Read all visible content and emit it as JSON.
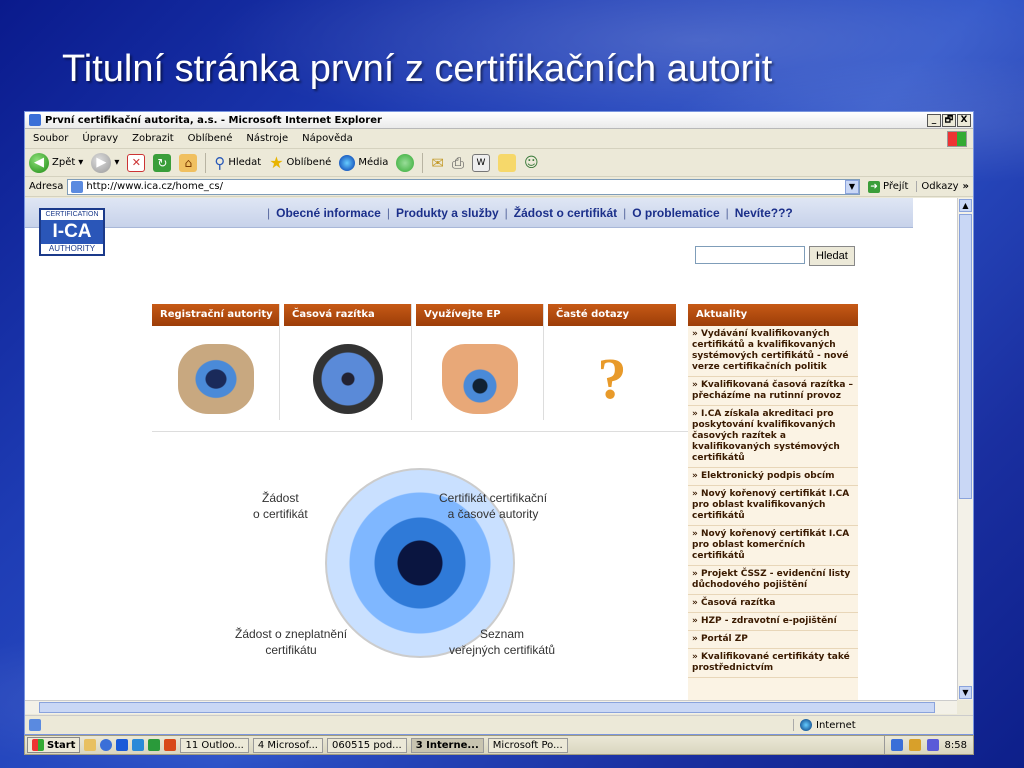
{
  "slide": {
    "title": "Titulní stránka první z certifikačních autorit"
  },
  "window": {
    "title": "První certifikační autorita, a.s. - Microsoft Internet Explorer",
    "controls": [
      "_",
      "🗗",
      "X"
    ]
  },
  "menu": [
    "Soubor",
    "Úpravy",
    "Zobrazit",
    "Oblíbené",
    "Nástroje",
    "Nápověda"
  ],
  "toolbar": {
    "back": "Zpět",
    "search": "Hledat",
    "favorites": "Oblíbené",
    "media": "Média"
  },
  "address": {
    "label": "Adresa",
    "url": "http://www.ica.cz/home_cs/",
    "go": "Přejít",
    "links": "Odkazy"
  },
  "site": {
    "logo": {
      "top": "CERTIFICATION",
      "mid": "I-CA",
      "bottom": "AUTHORITY"
    },
    "nav": [
      "Obecné informace",
      "Produkty a služby",
      "Žádost o certifikát",
      "O problematice",
      "Nevíte???"
    ],
    "search_button": "Hledat",
    "tabs": [
      "Registrační autority",
      "Časová razítka",
      "Využívejte EP",
      "Časté dotazy"
    ],
    "news_title": "Aktuality",
    "news": [
      "» Vydávání kvalifikovaných certifikátů a kvalifikovaných systémových certifikátů - nové verze certifikačních politik",
      "» Kvalifikovaná časová razítka – přecházíme na rutinní provoz",
      "» I.CA získala akreditaci pro poskytování kvalifikovaných časových razítek a kvalifikovaných systémových certifikátů",
      "» Elektronický podpis obcím",
      "» Nový kořenový certifikát I.CA pro oblast kvalifikovaných certifikátů",
      "» Nový kořenový certifikát I.CA pro oblast komerčních certifikátů",
      "» Projekt ČSSZ - evidenční listy důchodového pojištění",
      "» Časová razítka",
      "» HZP - zdravotní e-pojištění",
      "» Portál ZP",
      "» Kvalifikované certifikáty také prostřednictvím"
    ],
    "eye_labels": {
      "top_left": "Žádost\no certifikát",
      "top_right": "Certifikát certifikační\na časové autority",
      "bottom_left": "Žádost o zneplatnění\ncertifikátu",
      "bottom_right": "Seznam\nveřejných certifikátů"
    }
  },
  "status": {
    "zone": "Internet"
  },
  "taskbar": {
    "start": "Start",
    "tasks": [
      "11 Outloo...",
      "4 Microsof...",
      "060515 pod...",
      "3 Interne...",
      "Microsoft Po..."
    ],
    "clock": "8:58"
  }
}
